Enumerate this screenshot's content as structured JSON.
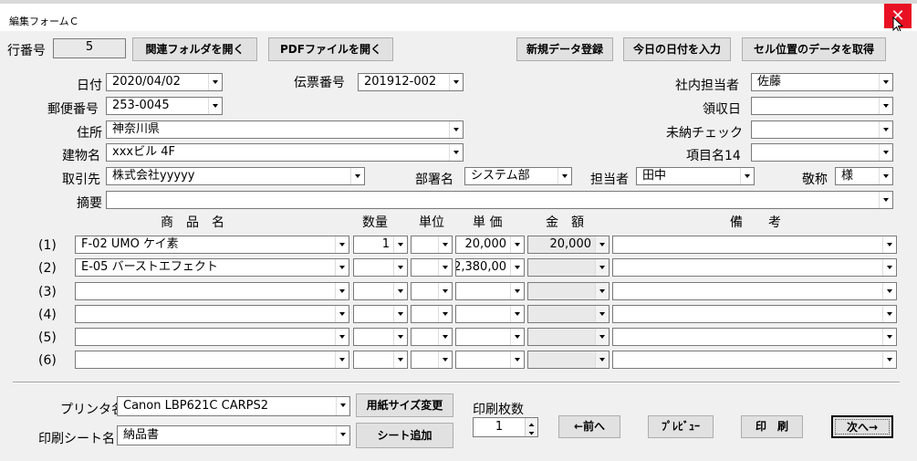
{
  "window": {
    "title": "編集フォームＣ",
    "close_glyph": "✕"
  },
  "top": {
    "row_no_label": "行番号",
    "row_no_value": "5",
    "buttons": [
      "関連フォルダを開く",
      "PDFファイルを開く",
      "新規データ登録",
      "今日の日付を入力",
      "セル位置のデータを取得"
    ]
  },
  "form": {
    "date_label": "日付",
    "date_value": "2020/04/02",
    "slip_label": "伝票番号",
    "slip_value": "201912-002",
    "staff_label": "社内担当者",
    "staff_value": "佐藤",
    "postal_label": "郵便番号",
    "postal_value": "253-0045",
    "receipt_label": "領収日",
    "receipt_value": "",
    "address_label": "住所",
    "address_value": "神奈川県",
    "unpaid_label": "未納チェック",
    "unpaid_value": "",
    "building_label": "建物名",
    "building_value": "xxxビル 4F",
    "item14_label": "項目名14",
    "item14_value": "",
    "client_label": "取引先",
    "client_value": "株式会社yyyyy",
    "dept_label": "部署名",
    "dept_value": "システム部",
    "person_label": "担当者",
    "person_value": "田中",
    "honorific_label": "敬称",
    "honorific_value": "様",
    "summary_label": "摘要",
    "summary_value": ""
  },
  "table": {
    "headers": {
      "product": "商　品　名",
      "qty": "数量",
      "unit": "単位",
      "price": "単 価",
      "amount": "金　額",
      "remarks": "備　　考"
    },
    "rows": [
      {
        "no": "(1)",
        "product": "F-02 UMO ケイ素",
        "qty": "1",
        "unit": "",
        "price": "20,000",
        "amount": "20,000",
        "remarks": ""
      },
      {
        "no": "(2)",
        "product": "E-05 バーストエフェクト",
        "qty": "",
        "unit": "",
        "price": "2,380,00",
        "amount": "",
        "remarks": ""
      },
      {
        "no": "(3)",
        "product": "",
        "qty": "",
        "unit": "",
        "price": "",
        "amount": "",
        "remarks": ""
      },
      {
        "no": "(4)",
        "product": "",
        "qty": "",
        "unit": "",
        "price": "",
        "amount": "",
        "remarks": ""
      },
      {
        "no": "(5)",
        "product": "",
        "qty": "",
        "unit": "",
        "price": "",
        "amount": "",
        "remarks": ""
      },
      {
        "no": "(6)",
        "product": "",
        "qty": "",
        "unit": "",
        "price": "",
        "amount": "",
        "remarks": ""
      }
    ]
  },
  "print": {
    "printer_label": "プリンタ名",
    "printer_value": "Canon LBP621C CARPS2",
    "paper_button": "用紙サイズ変更",
    "sheet_label": "印刷シート名",
    "sheet_value": "納品書",
    "add_sheet_button": "シート追加",
    "copies_label": "印刷枚数",
    "copies_value": "1",
    "prev_button": "←前へ",
    "preview_button": "ﾌﾟﾚﾋﾞｭｰ",
    "print_button": "印　刷",
    "next_button": "次へ→"
  }
}
